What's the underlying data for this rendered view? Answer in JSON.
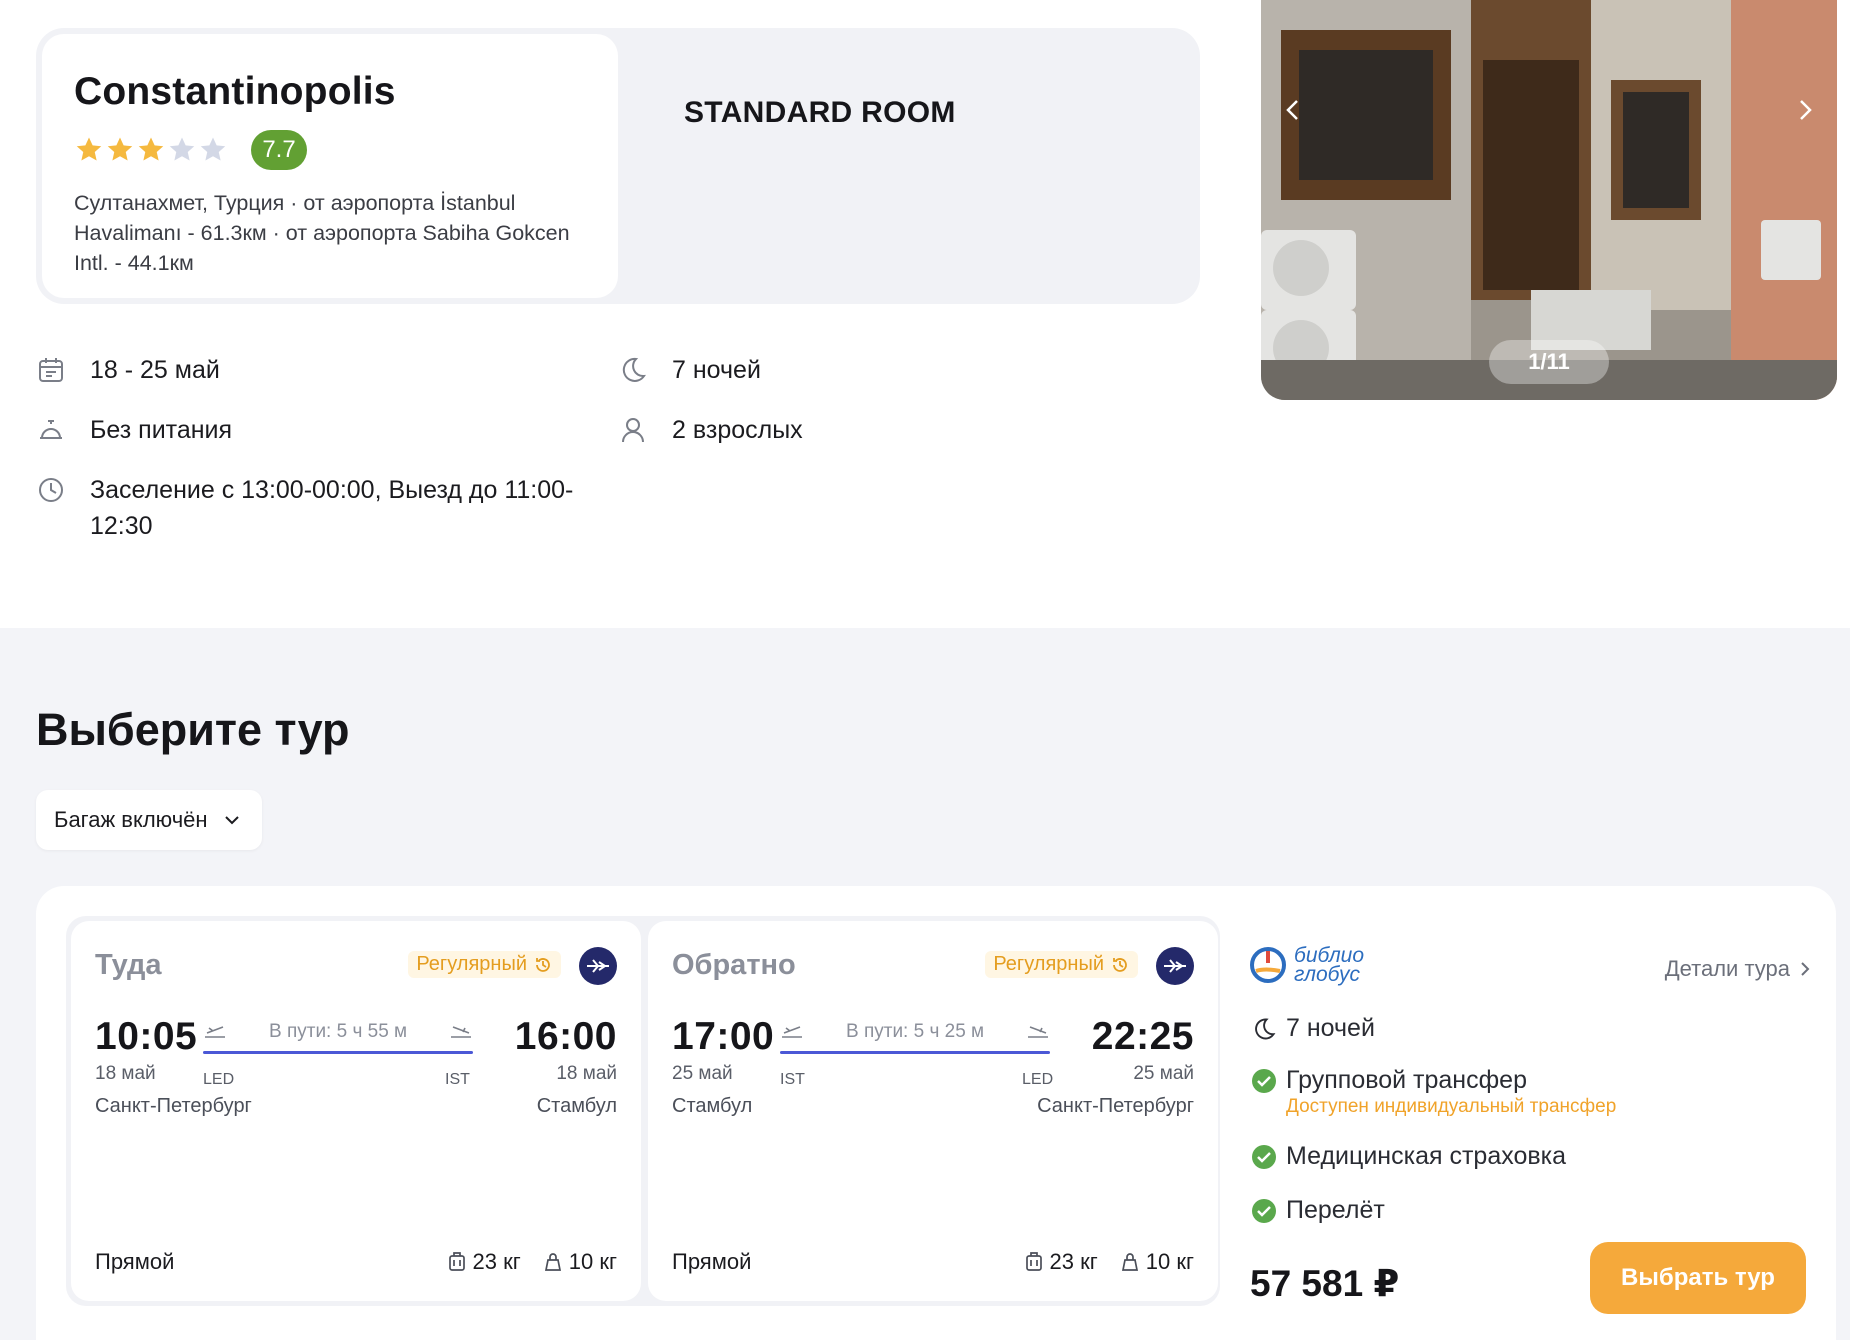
{
  "hotel": {
    "name": "Constantinopolis",
    "stars": 3,
    "max_stars": 5,
    "score": "7.7",
    "address": "Султанахмет, Турция · от аэропорта İstanbul Havalimanı - 61.3км · от аэропорта Sabiha Gokcen Intl. - 44.1км"
  },
  "room": {
    "title": "STANDARD ROOM"
  },
  "info": {
    "dates": "18 - 25 май",
    "nights": "7 ночей",
    "meal": "Без питания",
    "guests": "2 взрослых",
    "checkin": "Заселение с 13:00-00:00, Выезд до 11:00-12:30"
  },
  "photo": {
    "counter": "1/11"
  },
  "tours": {
    "title": "Выберите тур",
    "filter": "Багаж включён"
  },
  "flights": [
    {
      "direction": "Туда",
      "badge": "Регулярный",
      "dep_time": "10:05",
      "dep_date": "18 май",
      "dep_city": "Санкт-Петербург",
      "dep_code": "LED",
      "duration": "В пути: 5 ч 55 м",
      "arr_time": "16:00",
      "arr_date": "18 май",
      "arr_city": "Стамбул",
      "arr_code": "IST",
      "kind": "Прямой",
      "baggage": "23 кг",
      "hand": "10 кг"
    },
    {
      "direction": "Обратно",
      "badge": "Регулярный",
      "dep_time": "17:00",
      "dep_date": "25 май",
      "dep_city": "Стамбул",
      "dep_code": "IST",
      "duration": "В пути: 5 ч 25 м",
      "arr_time": "22:25",
      "arr_date": "25 май",
      "arr_city": "Санкт-Петербург",
      "arr_code": "LED",
      "kind": "Прямой",
      "baggage": "23 кг",
      "hand": "10 кг"
    }
  ],
  "summary": {
    "operator_line1": "библио",
    "operator_line2": "глобус",
    "details": "Детали тура",
    "nights": "7 ночей",
    "transfer": "Групповой трансфер",
    "transfer_note": "Доступен индивидуальный трансфер",
    "insurance": "Медицинская страховка",
    "flight": "Перелёт",
    "price": "57 581 ₽",
    "button": "Выбрать тур"
  },
  "colors": {
    "score_green": "#62a033",
    "check_green": "#5aa84c",
    "accent_orange": "#f5a93b",
    "route_blue": "#4b58d6",
    "airline_navy": "#24296a"
  }
}
